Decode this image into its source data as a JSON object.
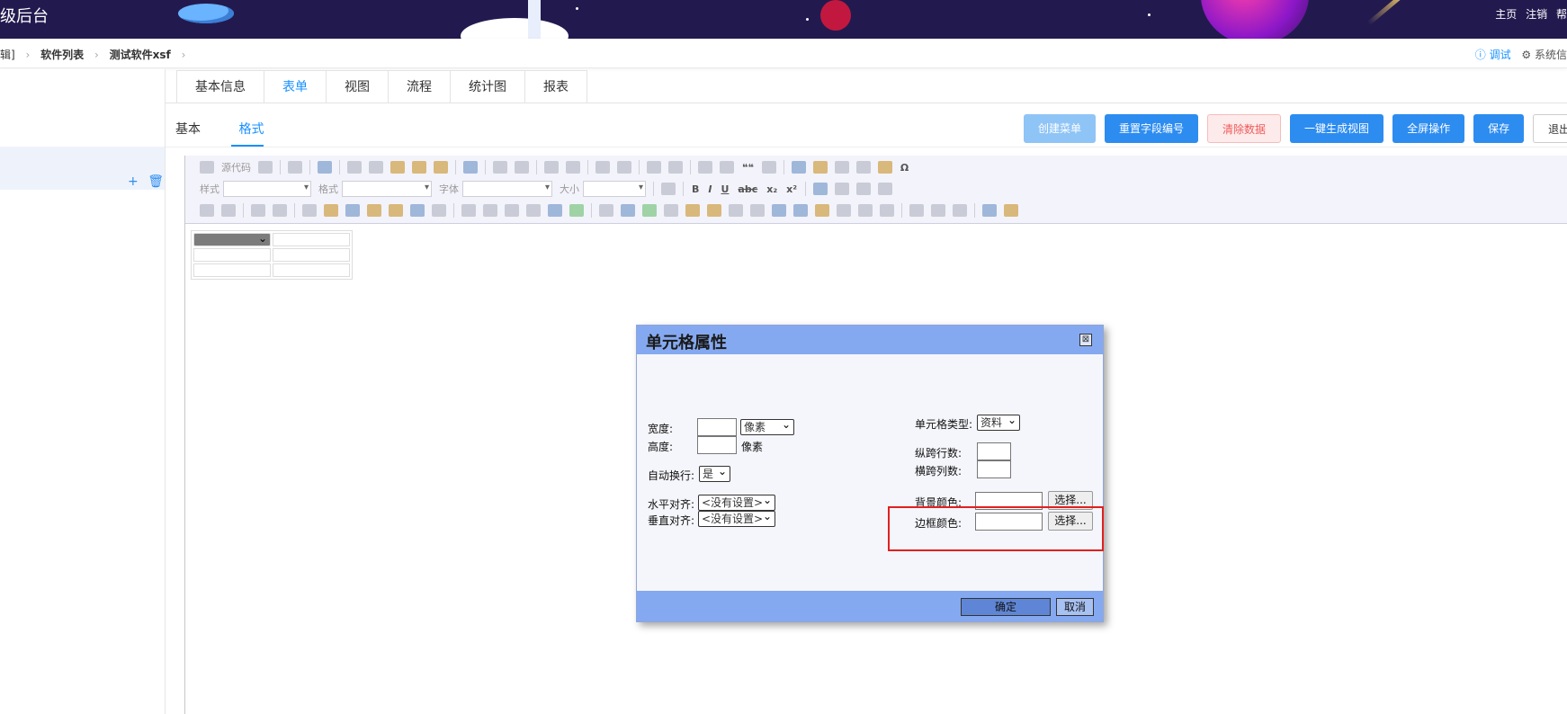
{
  "header": {
    "title": "级后台",
    "links": [
      "主页",
      "注销",
      "帮"
    ]
  },
  "breadcrumb": {
    "items": [
      "辑]",
      "软件列表",
      "测试软件xsf"
    ],
    "debug_label": "ⓘ 调试",
    "system_label": "⚙ 系统信"
  },
  "leftpanel": {
    "add_icon": "+",
    "delete_icon": "🗑"
  },
  "tabs": [
    {
      "label": "基本信息"
    },
    {
      "label": "表单"
    },
    {
      "label": "视图"
    },
    {
      "label": "流程"
    },
    {
      "label": "统计图"
    },
    {
      "label": "报表"
    }
  ],
  "subtabs": [
    {
      "label": "基本"
    },
    {
      "label": "格式"
    }
  ],
  "buttons": {
    "create_menu": "创建菜单",
    "reset_fields": "重置字段编号",
    "clear_data": "清除数据",
    "gen_view": "一键生成视图",
    "fullscreen": "全屏操作",
    "save": "保存",
    "exit": "退出"
  },
  "toolbar": {
    "source": "源代码",
    "style": "样式",
    "format": "格式",
    "font": "字体",
    "size": "大小",
    "bold": "B",
    "italic": "I",
    "underline": "U",
    "strike": "abc",
    "sub": "x₂",
    "sup": "x²",
    "omega": "Ω",
    "quote": "❝❝"
  },
  "dialog": {
    "title": "单元格属性",
    "close": "⊠",
    "width_label": "宽度:",
    "height_label": "高度:",
    "unit_px": "像素",
    "height_unit": "像素",
    "wrap_label": "自动换行:",
    "wrap_value": "是",
    "halign_label": "水平对齐:",
    "halign_value": "<没有设置>",
    "valign_label": "垂直对齐:",
    "valign_value": "<没有设置>",
    "celltype_label": "单元格类型:",
    "celltype_value": "资料",
    "rowspan_label": "纵跨行数:",
    "colspan_label": "横跨列数:",
    "bgcolor_label": "背景颜色:",
    "bordercolor_label": "边框颜色:",
    "choose1": "选择...",
    "choose2": "选择...",
    "ok": "确定",
    "cancel": "取消"
  },
  "colors": {
    "accent": "#1890ff",
    "dialog_bar": "#85a9f0",
    "highlight": "#e02020"
  }
}
